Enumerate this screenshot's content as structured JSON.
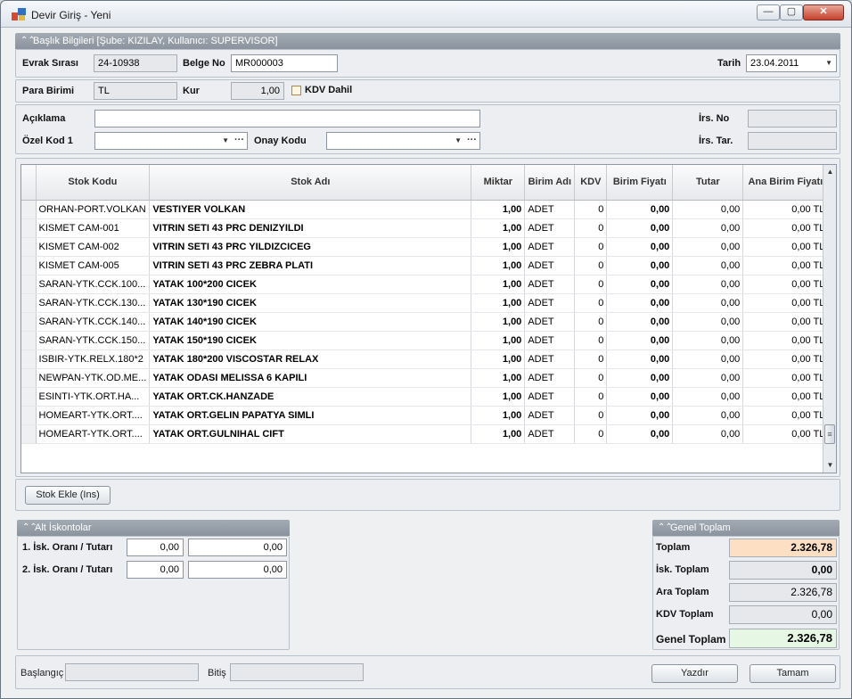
{
  "window": {
    "title": "Devir Giriş - Yeni",
    "min": "—",
    "max": "▢",
    "close": "✕"
  },
  "header_section": {
    "title": "Başlık Bilgileri [Şube: KIZILAY, Kullanıcı: SUPERVISOR]",
    "evrak_sirasi_label": "Evrak Sırası",
    "evrak_sirasi": "24-10938",
    "belge_no_label": "Belge No",
    "belge_no": "MR000003",
    "tarih_label": "Tarih",
    "tarih": "23.04.2011",
    "para_birimi_label": "Para Birimi",
    "para_birimi": "TL",
    "kur_label": "Kur",
    "kur": "1,00",
    "kdv_dahil_label": "KDV Dahil",
    "aciklama_label": "Açıklama",
    "aciklama": "",
    "irs_no_label": "İrs. No",
    "irs_no": "",
    "ozel_kod_label": "Özel Kod 1",
    "ozel_kod": "",
    "onay_kodu_label": "Onay Kodu",
    "onay_kodu": "",
    "irs_tar_label": "İrs. Tar.",
    "irs_tar": ""
  },
  "grid": {
    "columns": [
      "Stok Kodu",
      "Stok Adı",
      "Miktar",
      "Birim Adı",
      "KDV",
      "Birim Fiyatı",
      "Tutar",
      "Ana Birim Fiyatı"
    ],
    "rows": [
      [
        "ORHAN-PORT.VOLKAN",
        "VESTIYER VOLKAN",
        "1,00",
        "ADET",
        "0",
        "0,00",
        "0,00",
        "0,00 TL"
      ],
      [
        "KISMET CAM-001",
        "VITRIN SETI 43 PRC DENIZYILDI",
        "1,00",
        "ADET",
        "0",
        "0,00",
        "0,00",
        "0,00 TL"
      ],
      [
        "KISMET CAM-002",
        "VITRIN SETI 43 PRC YILDIZCICEG",
        "1,00",
        "ADET",
        "0",
        "0,00",
        "0,00",
        "0,00 TL"
      ],
      [
        "KISMET CAM-005",
        "VITRIN SETI 43 PRC ZEBRA PLATI",
        "1,00",
        "ADET",
        "0",
        "0,00",
        "0,00",
        "0,00 TL"
      ],
      [
        "SARAN-YTK.CCK.100...",
        "YATAK 100*200 CICEK",
        "1,00",
        "ADET",
        "0",
        "0,00",
        "0,00",
        "0,00 TL"
      ],
      [
        "SARAN-YTK.CCK.130...",
        "YATAK 130*190 CICEK",
        "1,00",
        "ADET",
        "0",
        "0,00",
        "0,00",
        "0,00 TL"
      ],
      [
        "SARAN-YTK.CCK.140...",
        "YATAK 140*190 CICEK",
        "1,00",
        "ADET",
        "0",
        "0,00",
        "0,00",
        "0,00 TL"
      ],
      [
        "SARAN-YTK.CCK.150...",
        "YATAK 150*190 CICEK",
        "1,00",
        "ADET",
        "0",
        "0,00",
        "0,00",
        "0,00 TL"
      ],
      [
        "ISBIR-YTK.RELX.180*2",
        "YATAK 180*200 VISCOSTAR RELAX",
        "1,00",
        "ADET",
        "0",
        "0,00",
        "0,00",
        "0,00 TL"
      ],
      [
        "NEWPAN-YTK.OD.ME...",
        "YATAK ODASI MELISSA 6 KAPILI",
        "1,00",
        "ADET",
        "0",
        "0,00",
        "0,00",
        "0,00 TL"
      ],
      [
        "ESINTI-YTK.ORT.HA...",
        "YATAK ORT.CK.HANZADE",
        "1,00",
        "ADET",
        "0",
        "0,00",
        "0,00",
        "0,00 TL"
      ],
      [
        "HOMEART-YTK.ORT....",
        "YATAK ORT.GELIN PAPATYA SIMLI",
        "1,00",
        "ADET",
        "0",
        "0,00",
        "0,00",
        "0,00 TL"
      ],
      [
        "HOMEART-YTK.ORT....",
        "YATAK ORT.GULNIHAL CIFT",
        "1,00",
        "ADET",
        "0",
        "0,00",
        "0,00",
        "0,00 TL"
      ]
    ]
  },
  "stok_ekle_button": "Stok Ekle (Ins)",
  "alt_iskontolar": {
    "title": "Alt İskontolar",
    "row1_label": "1. İsk. Oranı / Tutarı",
    "row1_oran": "0,00",
    "row1_tutar": "0,00",
    "row2_label": "2. İsk. Oranı / Tutarı",
    "row2_oran": "0,00",
    "row2_tutar": "0,00"
  },
  "genel_toplam": {
    "title": "Genel Toplam",
    "toplam_label": "Toplam",
    "toplam": "2.326,78",
    "isk_toplam_label": "İsk. Toplam",
    "isk_toplam": "0,00",
    "ara_toplam_label": "Ara Toplam",
    "ara_toplam": "2.326,78",
    "kdv_toplam_label": "KDV Toplam",
    "kdv_toplam": "0,00",
    "genel_toplam_label": "Genel Toplam",
    "genel_toplam": "2.326,78"
  },
  "footer": {
    "baslangic_label": "Başlangıç",
    "baslangic": "",
    "bitis_label": "Bitiş",
    "bitis": "",
    "yazdir_button": "Yazdır",
    "tamam_button": "Tamam"
  },
  "colors": {
    "toplam_bg": "#fde0c3",
    "genel_toplam_bg": "#e6f8e3",
    "header_bar": "#8f98a2"
  }
}
